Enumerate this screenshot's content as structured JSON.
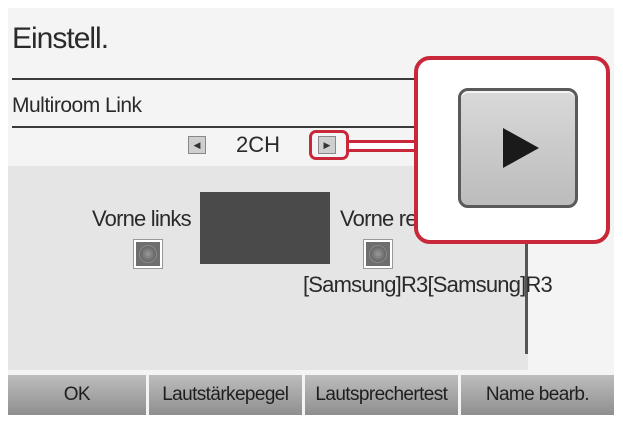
{
  "header": {
    "title": "Einstell."
  },
  "menu": {
    "item_label": "Multiroom Link"
  },
  "channel": {
    "left_arrow_icon": "left-arrow",
    "right_arrow_icon": "right-arrow",
    "value": "2CH"
  },
  "speakers": {
    "front_left_label": "Vorne links",
    "front_right_label": "Vorne re",
    "device_name": "[Samsung]R3[Samsung]R3"
  },
  "zoom": {
    "icon": "play-icon"
  },
  "buttons": [
    {
      "label": "OK"
    },
    {
      "label": "Lautstärkepegel"
    },
    {
      "label": "Lautsprechertest"
    },
    {
      "label": "Name bearb."
    }
  ],
  "colors": {
    "highlight": "#c8283a",
    "button_bg": "#a5a5a5",
    "panel_bg": "#e5e5e5"
  }
}
